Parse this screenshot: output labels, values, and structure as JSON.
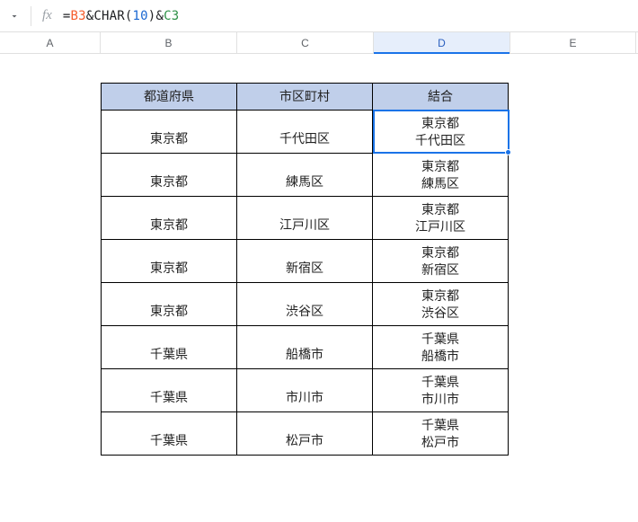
{
  "formula_bar": {
    "fx_label": "fx",
    "eq": "=",
    "ref1": "B3",
    "amp1": "&",
    "fn": "CHAR",
    "open": "(",
    "num": "10",
    "close": ")",
    "amp2": "&",
    "ref2": "C3"
  },
  "columns": {
    "A": "A",
    "B": "B",
    "C": "C",
    "D": "D",
    "E": "E"
  },
  "headers": {
    "b": "都道府県",
    "c": "市区町村",
    "d": "結合"
  },
  "rows": [
    {
      "b": "東京都",
      "c": "千代田区",
      "d": "東京都\n千代田区"
    },
    {
      "b": "東京都",
      "c": "練馬区",
      "d": "東京都\n練馬区"
    },
    {
      "b": "東京都",
      "c": "江戸川区",
      "d": "東京都\n江戸川区"
    },
    {
      "b": "東京都",
      "c": "新宿区",
      "d": "東京都\n新宿区"
    },
    {
      "b": "東京都",
      "c": "渋谷区",
      "d": "東京都\n渋谷区"
    },
    {
      "b": "千葉県",
      "c": "船橋市",
      "d": "千葉県\n船橋市"
    },
    {
      "b": "千葉県",
      "c": "市川市",
      "d": "千葉県\n市川市"
    },
    {
      "b": "千葉県",
      "c": "松戸市",
      "d": "千葉県\n松戸市"
    }
  ],
  "selected_cell": "D3"
}
